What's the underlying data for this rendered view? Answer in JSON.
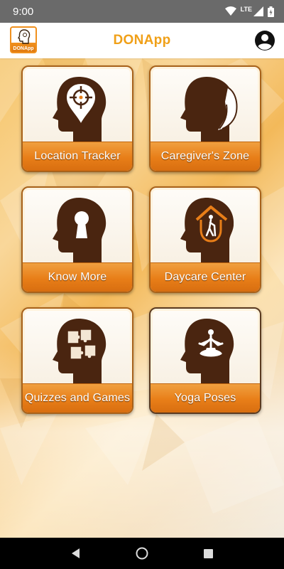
{
  "status_bar": {
    "time": "9:00",
    "network": "LTE",
    "icons": [
      "wifi-icon",
      "cell-signal-icon",
      "battery-icon"
    ]
  },
  "app_bar": {
    "title": "DONApp",
    "logo_text": "DONApp",
    "profile_icon": "account-circle-icon"
  },
  "tiles": [
    {
      "label": "Location Tracker",
      "icon": "head-target-icon"
    },
    {
      "label": "Caregiver's Zone",
      "icon": "head-hand-icon"
    },
    {
      "label": "Know More",
      "icon": "head-keyhole-icon"
    },
    {
      "label": "Daycare Center",
      "icon": "head-home-walker-icon"
    },
    {
      "label": "Quizzes and Games",
      "icon": "head-puzzle-icon"
    },
    {
      "label": "Yoga Poses",
      "icon": "head-yoga-icon"
    }
  ],
  "nav_bar": {
    "buttons": [
      "back-icon",
      "home-icon",
      "recents-icon"
    ]
  },
  "colors": {
    "accent": "#f0a018",
    "tile_label_bar": "#e87e18",
    "head_brown": "#4a2510",
    "status_bar": "#6a6a6a"
  }
}
